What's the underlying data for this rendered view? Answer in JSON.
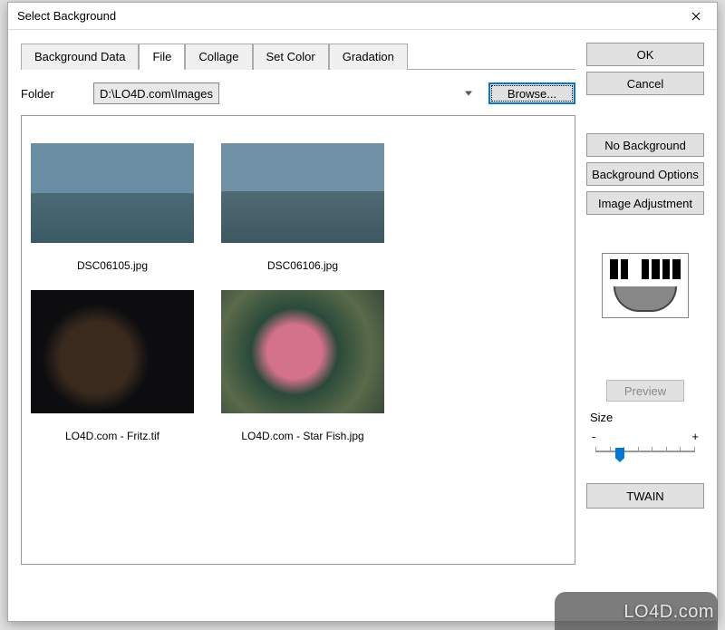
{
  "window": {
    "title": "Select Background"
  },
  "tabs": {
    "items": [
      {
        "label": "Background Data"
      },
      {
        "label": "File"
      },
      {
        "label": "Collage"
      },
      {
        "label": "Set Color"
      },
      {
        "label": "Gradation"
      }
    ],
    "active_index": 1
  },
  "folder": {
    "label": "Folder",
    "path": "D:\\LO4D.com\\Images",
    "browse_label": "Browse..."
  },
  "thumbnails": [
    {
      "name": "DSC06105.jpg",
      "icon": "city1"
    },
    {
      "name": "DSC06106.jpg",
      "icon": "city2"
    },
    {
      "name": "LO4D.com - Fritz.tif",
      "icon": "cat"
    },
    {
      "name": "LO4D.com - Star Fish.jpg",
      "icon": "star"
    }
  ],
  "buttons": {
    "ok": "OK",
    "cancel": "Cancel",
    "no_background": "No Background",
    "background_options": "Background Options",
    "image_adjustment": "Image Adjustment",
    "preview": "Preview",
    "twain": "TWAIN"
  },
  "size": {
    "label": "Size",
    "minus": "-",
    "plus": "+"
  },
  "watermark": "LO4D.com"
}
